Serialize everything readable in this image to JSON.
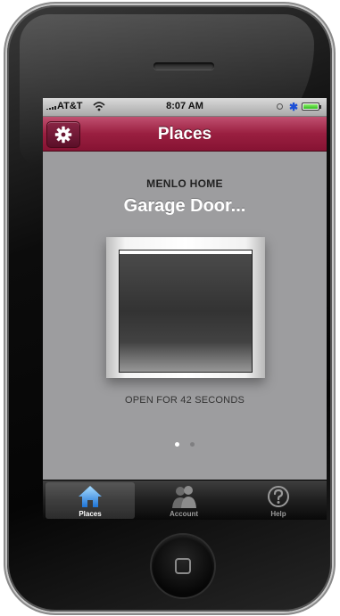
{
  "status_bar": {
    "carrier": "AT&T",
    "time": "8:07 AM",
    "wifi_icon": "wifi-icon",
    "bluetooth_icon": "bluetooth-icon",
    "battery_icon": "battery-icon",
    "battery_level": 1.0
  },
  "nav_bar": {
    "title": "Places",
    "settings_icon": "gear-icon",
    "accent_color": "#9a1f40"
  },
  "place": {
    "name": "MENLO HOME",
    "door_title": "Garage Door...",
    "status": "OPEN FOR 42 SECONDS",
    "door_icon": "garage-door-icon"
  },
  "pagination": {
    "current": 1,
    "total": 2
  },
  "tab_bar": {
    "tabs": [
      {
        "label": "Places",
        "icon": "home-icon",
        "active": true
      },
      {
        "label": "Account",
        "icon": "people-icon",
        "active": false
      },
      {
        "label": "Help",
        "icon": "help-icon",
        "active": false
      }
    ]
  }
}
